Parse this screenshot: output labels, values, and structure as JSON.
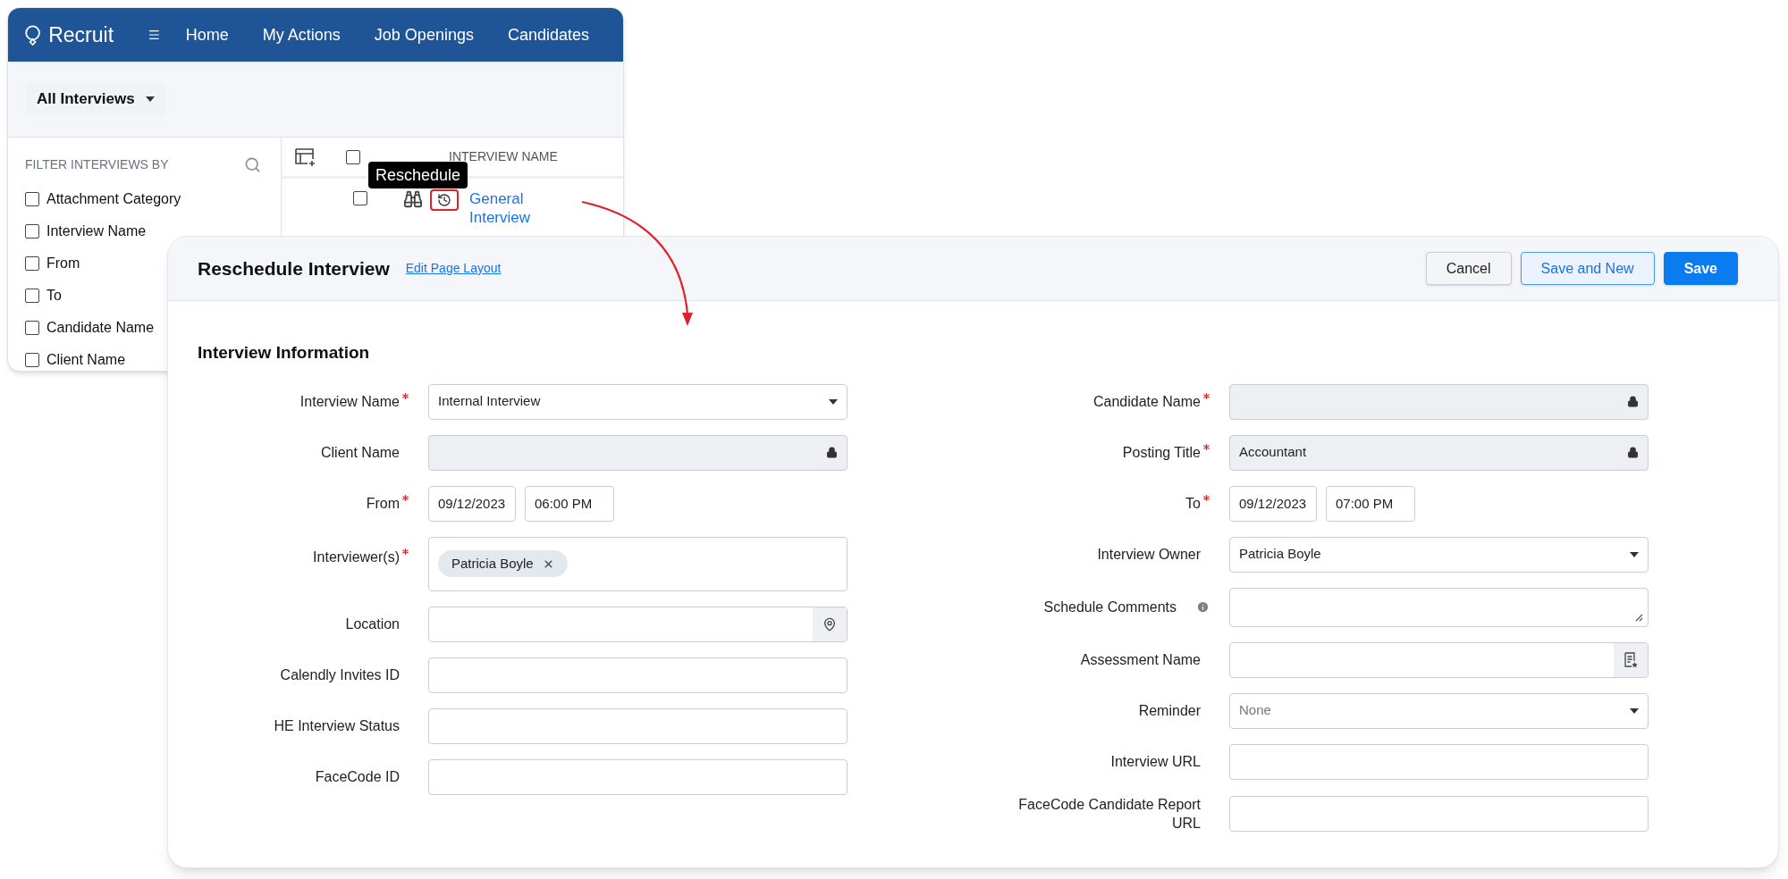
{
  "app": {
    "brand": "Recruit",
    "nav": [
      {
        "label": "Home"
      },
      {
        "label": "My Actions"
      },
      {
        "label": "Job Openings"
      },
      {
        "label": "Candidates"
      }
    ],
    "view_selector": "All Interviews",
    "filter": {
      "title": "FILTER INTERVIEWS BY",
      "items": [
        {
          "label": "Attachment Category",
          "checked": false
        },
        {
          "label": "Interview Name",
          "checked": false
        },
        {
          "label": "From",
          "checked": false
        },
        {
          "label": "To",
          "checked": false
        },
        {
          "label": "Candidate Name",
          "checked": false
        },
        {
          "label": "Client Name",
          "checked": false
        }
      ]
    },
    "table": {
      "columns": [
        "INTERVIEW NAME"
      ],
      "header_checked": false,
      "rows": [
        {
          "checked": false,
          "name": "General Interview"
        }
      ]
    },
    "tooltip": "Reschedule"
  },
  "form": {
    "title": "Reschedule Interview",
    "link": "Edit Page Layout",
    "buttons": [
      {
        "label": "Cancel",
        "kind": "secondary"
      },
      {
        "label": "Save and New",
        "kind": "outline"
      },
      {
        "label": "Save",
        "kind": "primary"
      }
    ],
    "section": "Interview Information",
    "left_fields": [
      {
        "label": "Interview Name",
        "required": true,
        "kind": "select",
        "value": "Internal Interview"
      },
      {
        "label": "Client Name",
        "required": false,
        "kind": "locked"
      },
      {
        "label": "From",
        "required": true,
        "kind": "datetime",
        "date": "09/12/2023",
        "time": "06:00 PM"
      },
      {
        "label": "Interviewer(s)",
        "required": true,
        "kind": "chips",
        "chips": [
          "Patricia Boyle"
        ]
      },
      {
        "label": "Location",
        "required": false,
        "kind": "location"
      },
      {
        "label": "Calendly Invites ID",
        "required": false,
        "kind": "text"
      },
      {
        "label": "HE Interview Status",
        "required": false,
        "kind": "text"
      },
      {
        "label": "FaceCode ID",
        "required": false,
        "kind": "text"
      }
    ],
    "right_fields": [
      {
        "label": "Candidate Name",
        "required": true,
        "kind": "locked"
      },
      {
        "label": "Posting Title",
        "required": true,
        "kind": "locked",
        "value": "Accountant"
      },
      {
        "label": "To",
        "required": true,
        "kind": "datetime",
        "date": "09/12/2023",
        "time": "07:00 PM"
      },
      {
        "label": "Interview Owner",
        "required": false,
        "kind": "select",
        "value": "Patricia Boyle"
      },
      {
        "label": "Schedule Comments",
        "required": false,
        "kind": "textarea",
        "info": true
      },
      {
        "label": "Assessment Name",
        "required": false,
        "kind": "lookup"
      },
      {
        "label": "Reminder",
        "required": false,
        "kind": "select",
        "placeholder": "None"
      },
      {
        "label": "Interview URL",
        "required": false,
        "kind": "text"
      },
      {
        "label": "FaceCode Candidate Report URL",
        "required": false,
        "kind": "text"
      }
    ]
  }
}
